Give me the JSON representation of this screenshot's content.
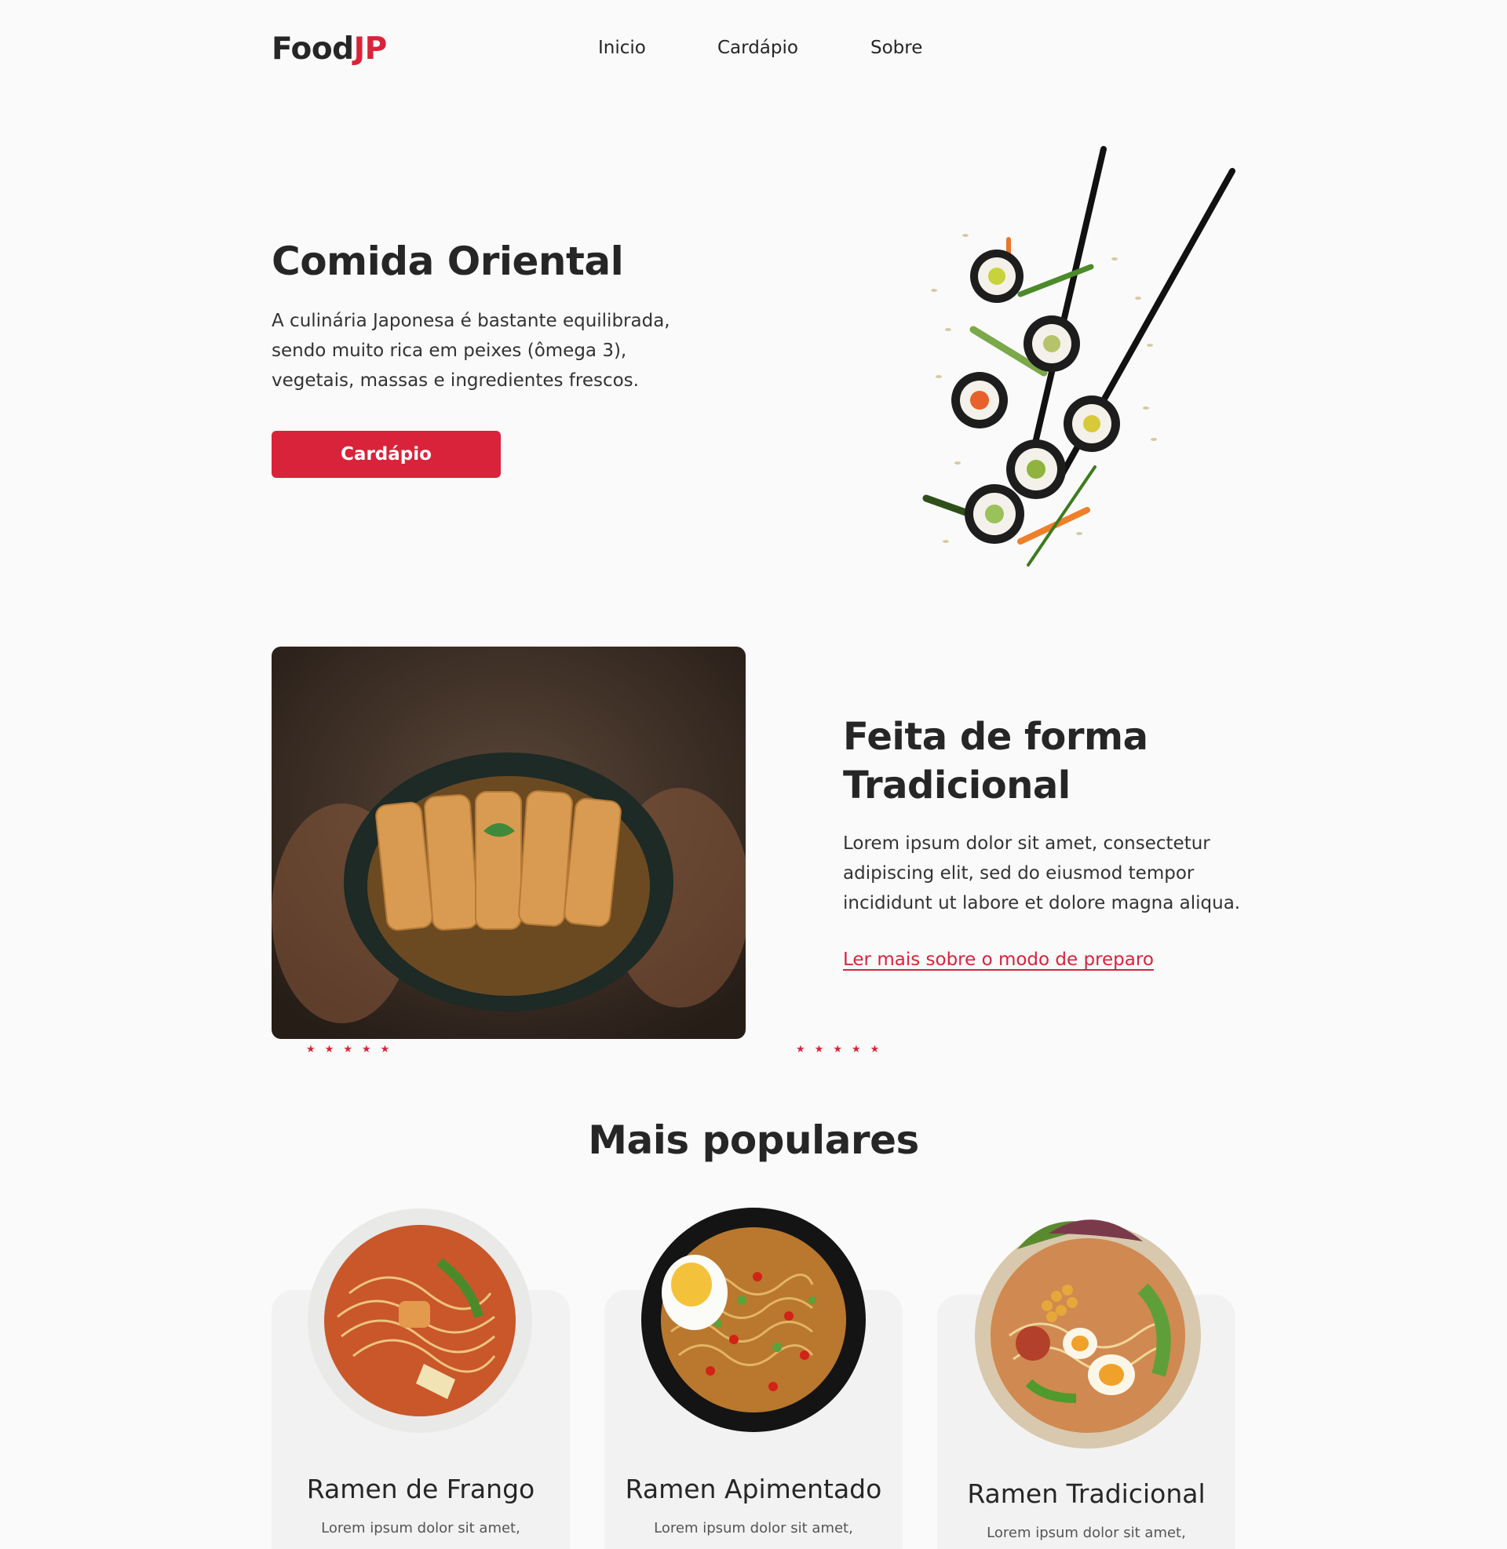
{
  "brand": {
    "name_main": "Food",
    "name_accent": "JP",
    "accent_color": "#d9233a"
  },
  "nav": {
    "items": [
      "Inicio",
      "Cardápio",
      "Sobre"
    ]
  },
  "hero": {
    "title": "Comida Oriental",
    "description": "A culinária Japonesa é bastante equilibrada, sendo muito rica em peixes (ômega 3), vegetais, massas e ingredientes frescos.",
    "cta_label": "Cardápio"
  },
  "tradition": {
    "title_line1": "Feita de forma",
    "title_line2": "Tradicional",
    "description": "Lorem ipsum dolor sit amet, consectetur adipiscing elit, sed do eiusmod tempor incididunt ut labore et dolore magna aliqua.",
    "link_label": "Ler mais sobre o modo de preparo"
  },
  "popular": {
    "title": "Mais populares",
    "items": [
      {
        "name": "Ramen de Frango",
        "desc": "Lorem ipsum dolor sit amet,"
      },
      {
        "name": "Ramen Apimentado",
        "desc": "Lorem ipsum dolor sit amet,"
      },
      {
        "name": "Ramen Tradicional",
        "desc": "Lorem ipsum dolor sit amet,"
      }
    ]
  }
}
